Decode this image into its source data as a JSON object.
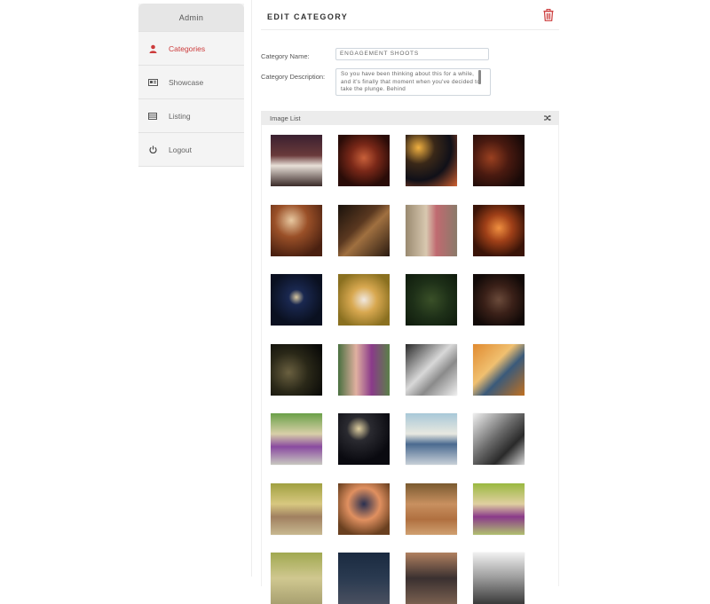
{
  "sidebar": {
    "header": "Admin",
    "items": [
      {
        "label": "Categories",
        "icon": "user-icon",
        "active": true
      },
      {
        "label": "Showcase",
        "icon": "id-card-icon",
        "active": false
      },
      {
        "label": "Listing",
        "icon": "list-icon",
        "active": false
      },
      {
        "label": "Logout",
        "icon": "power-icon",
        "active": false
      }
    ]
  },
  "main": {
    "title": "EDIT CATEGORY",
    "delete_icon": "trash-icon",
    "form": {
      "name_label": "Category Name:",
      "name_value": "ENGAGEMENT SHOOTS",
      "description_label": "Category Description:",
      "description_value": "So you have been thinking about this for a while, and it's finally that moment when you've decided to take the plunge. Behind"
    },
    "image_list": {
      "title": "Image List",
      "shuffle_icon": "shuffle-icon"
    }
  },
  "colors": {
    "accent": "#cc3b3b",
    "sidebar_bg": "#f4f4f4",
    "sidebar_header_bg": "#e6e6e6",
    "panel_header_bg": "#ececec"
  },
  "thumbnails": [
    "linear-gradient(180deg,#3a2030 0%,#6a3a3a 40%,#e8e0d8 60%,#3a2a28 100%)",
    "radial-gradient(circle at 50% 45%,#c8603a 0%,#7a2818 35%,#2a0c08 75%)",
    "radial-gradient(circle at 25% 25%,#f0b040 0%,#3a2818 30%,#101018 60%,#d06030 100%)",
    "radial-gradient(circle at 35% 45%,#9a4020 0%,#4a1a10 40%,#1a0a08 80%)",
    "radial-gradient(circle at 40% 30%,#e8c8a0 0%,#9a5028 35%,#4a2010 80%)",
    "linear-gradient(135deg,#1a120c 0%,#5a3820 40%,#a07040 55%,#2a1a10 100%)",
    "linear-gradient(90deg,#9a8a70 0%,#d8c8b0 40%,#c06a70 60%,#8a7a6a 100%)",
    "radial-gradient(circle at 50% 45%,#f09040 0%,#a04018 35%,#3a1408 75%)",
    "radial-gradient(circle at 50% 45%,#d8c8a0 0%,#1a2850 20%,#0a1020 70%)",
    "radial-gradient(circle at 50% 50%,#f0e8e0 0%,#d8a850 35%,#8a7020 80%)",
    "radial-gradient(circle at 50% 50%,#3a5028 0%,#1e3018 50%,#0e1a0c 100%)",
    "radial-gradient(circle at 50% 50%,#6a4a3a 0%,#3a2018 40%,#120a08 80%)",
    "radial-gradient(circle at 35% 55%,#6a6040 0%,#2a2818 45%,#0a0a08 90%)",
    "linear-gradient(90deg,#4a7040 0%,#e0b0a0 35%,#8a3a8a 65%,#5a8048 100%)",
    "linear-gradient(135deg,#2a2a2a 0%,#d8d8d8 45%,#8a8a8a 65%,#f0f0f0 100%)",
    "linear-gradient(135deg,#e08a30 0%,#f0c070 40%,#3a5a7a 60%,#c07020 100%)",
    "linear-gradient(180deg,#6aa048 0%,#d8d0a8 40%,#8a4aa0 65%,#c8c8c0 100%)",
    "radial-gradient(circle at 40% 30%,#e0d0a0 0%,#2a2a30 25%,#0a0a10 70%)",
    "linear-gradient(180deg,#a8c8d8 0%,#e8e8e0 40%,#4a6a90 60%,#c8d0d8 100%)",
    "linear-gradient(135deg,#f0f0f0 0%,#6a6a6a 45%,#2a2a2a 70%,#d8d8d8 100%)",
    "linear-gradient(180deg,#a0a040 0%,#d8c880 40%,#a08060 65%,#c8b890 100%)",
    "radial-gradient(circle at 50% 40%,#2a3050 0%,#e09060 40%,#6a4020 80%)",
    "linear-gradient(180deg,#7a5a30 0%,#c89060 40%,#b07040 70%,#d0a070 100%)",
    "linear-gradient(180deg,#9ab840 0%,#e0d0a0 40%,#8a3a8a 65%,#b0c070 100%)",
    "linear-gradient(180deg,#a0a850 0%,#d0c890 50%,#a8a070 100%)",
    "linear-gradient(180deg,#1a2a40 0%,#2a3a50 50%,#4a5060 100%)",
    "linear-gradient(180deg,#b08060 0%,#3a3030 50%,#7a6050 100%)",
    "linear-gradient(180deg,#f0f0f0 0%,#9a9a9a 50%,#3a3a3a 100%)"
  ]
}
